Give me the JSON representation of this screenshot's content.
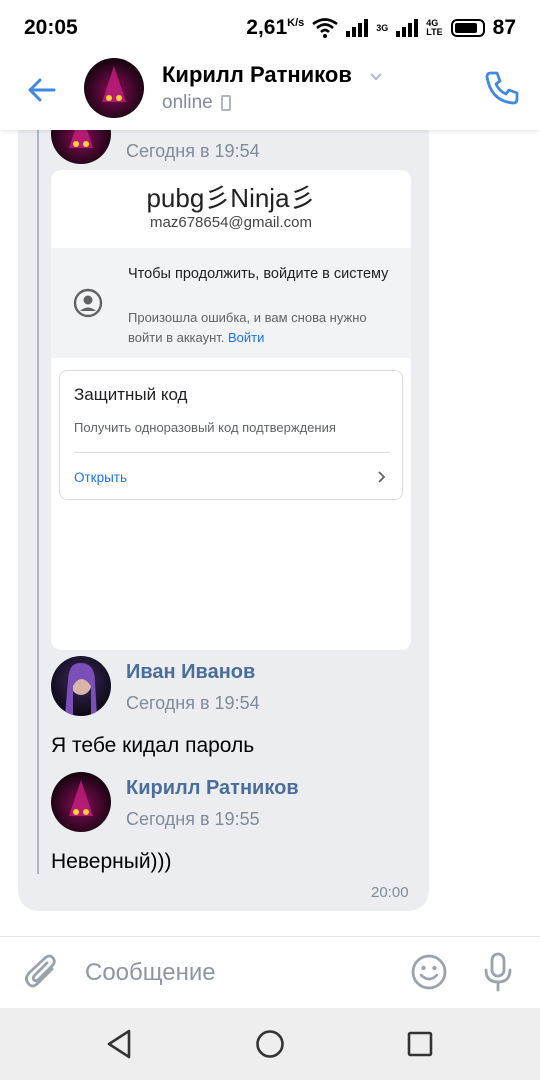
{
  "status_bar": {
    "time": "20:05",
    "speed": "2,61",
    "speed_unit": "K/s",
    "net_3g": "3G",
    "net_4g": "4G",
    "net_lte": "LTE",
    "battery": "87"
  },
  "header": {
    "name": "Кирилл Ратников",
    "status": "online"
  },
  "chat": {
    "quoted_time": "Сегодня в 19:54",
    "screenshot": {
      "logo_text": "pubg彡Ninja彡",
      "email": "maz678654@gmail.com",
      "prompt_title": "Чтобы продолжить, войдите в систему",
      "prompt_desc": "Произошла ошибка, и вам снова нужно войти в аккаунт.",
      "prompt_link": "Войти",
      "card_title": "Защитный код",
      "card_desc": "Получить одноразовый код подтверждения",
      "card_link": "Открыть"
    },
    "messages": [
      {
        "sender": "Иван Иванов",
        "time": "Сегодня в 19:54",
        "text": "Я тебе кидал пароль"
      },
      {
        "sender": "Кирилл Ратников",
        "time": "Сегодня в 19:55",
        "text": "Неверный)))"
      }
    ],
    "bubble_time": "20:00"
  },
  "input": {
    "placeholder": "Сообщение"
  },
  "colors": {
    "accent": "#3f8ae0",
    "sender": "#4a6e99",
    "bubble": "#ebedf0",
    "muted": "#818c99"
  },
  "icons": [
    "back-arrow-icon",
    "chevron-down-icon",
    "phone-call-icon",
    "paperclip-icon",
    "emoji-icon",
    "microphone-icon",
    "nav-back-icon",
    "nav-home-icon",
    "nav-recents-icon"
  ]
}
